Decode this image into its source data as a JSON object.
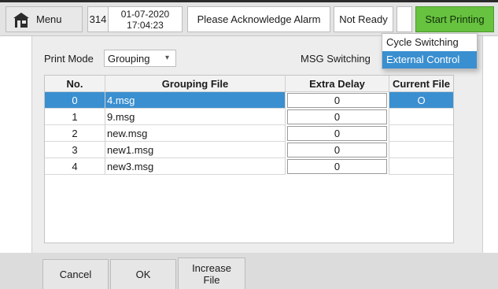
{
  "topbar": {
    "menu_label": "Menu",
    "counter": "314",
    "date": "01-07-2020",
    "time": "17:04:23",
    "alarm": "Please Acknowledge Alarm",
    "status": "Not Ready",
    "start_label": "Start Printing",
    "start_color": "#67c23f"
  },
  "print_mode": {
    "label": "Print Mode",
    "value": "Grouping"
  },
  "msg_switching": {
    "label": "MSG Switching",
    "options": [
      "Cycle Switching",
      "External Control"
    ],
    "selected": "External Control"
  },
  "table": {
    "headers": [
      "No.",
      "Grouping File",
      "Extra Delay",
      "Current File"
    ],
    "rows": [
      {
        "no": "0",
        "file": "4.msg",
        "delay": "0",
        "current": "O",
        "selected": true
      },
      {
        "no": "1",
        "file": "9.msg",
        "delay": "0",
        "current": ""
      },
      {
        "no": "2",
        "file": "new.msg",
        "delay": "0",
        "current": ""
      },
      {
        "no": "3",
        "file": "new1.msg",
        "delay": "0",
        "current": ""
      },
      {
        "no": "4",
        "file": "new3.msg",
        "delay": "0",
        "current": ""
      }
    ],
    "selection_color": "#3a8fd0"
  },
  "buttons": {
    "cancel": "Cancel",
    "ok": "OK",
    "increase_line1": "Increase",
    "increase_line2": "File"
  }
}
